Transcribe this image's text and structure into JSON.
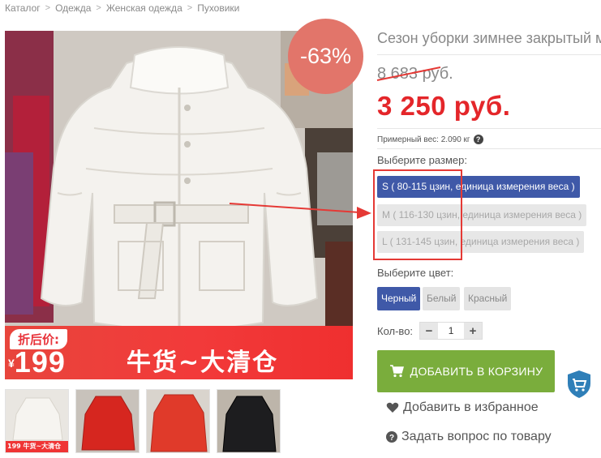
{
  "breadcrumb": [
    "Каталог",
    "Одежда",
    "Женская одежда",
    "Пуховики"
  ],
  "discount": "-63%",
  "image_promo": {
    "label": "折后价:",
    "currency": "¥",
    "price": "199",
    "slogan": "牛货~大清仓"
  },
  "thumbnails": [
    {
      "caption": "199   牛货~大清仓",
      "color": "#ebe8e3"
    },
    {
      "caption": "",
      "color": "#d6261f"
    },
    {
      "caption": "",
      "color": "#e03a2a"
    },
    {
      "caption": "",
      "color": "#1d1d1f"
    }
  ],
  "product": {
    "title": "Сезон уборки зимнее закрытый м",
    "old_price": "8 683 руб.",
    "price": "3 250 руб.",
    "weight": "Примерный вес: 2.090 кг"
  },
  "size": {
    "label": "Выберите размер:",
    "options": [
      {
        "label": "S ( 80-115 цзин, единица измерения веса )",
        "selected": true
      },
      {
        "label": "M ( 116-130 цзин, единица измерения веса )",
        "selected": false
      },
      {
        "label": "L ( 131-145 цзин, единица измерения веса )",
        "selected": false
      }
    ]
  },
  "color": {
    "label": "Выберите цвет:",
    "options": [
      {
        "label": "Черный",
        "selected": true
      },
      {
        "label": "Белый",
        "selected": false
      },
      {
        "label": "Красный",
        "selected": false
      }
    ]
  },
  "quantity": {
    "label": "Кол-во:",
    "value": "1",
    "minus": "−",
    "plus": "+"
  },
  "actions": {
    "add_to_cart": "ДОБАВИТЬ В КОРЗИНУ",
    "favorite": "Добавить в избранное",
    "question": "Задать вопрос по товару"
  },
  "colors": {
    "accent_blue": "#3f59a8",
    "price_red": "#e4262a",
    "cart_green": "#7aad3c",
    "badge": "#e2756a",
    "annotation_red": "#e53935"
  }
}
